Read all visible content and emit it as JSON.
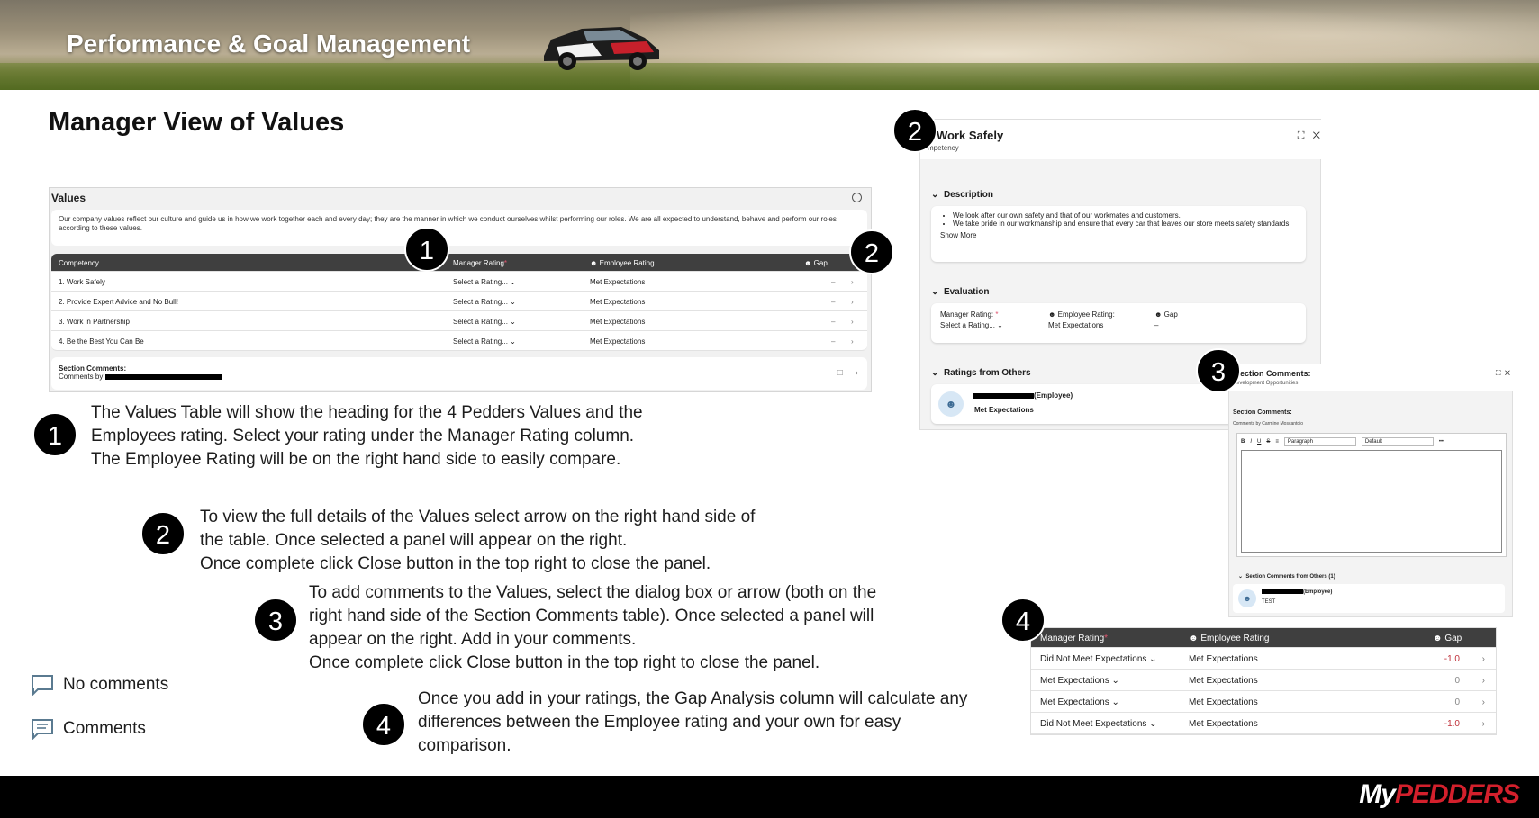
{
  "header": {
    "title": "Performance & Goal Management"
  },
  "page_title": "Manager View of Values",
  "values_table": {
    "title": "Values",
    "description": "Our company values reflect our culture and guide us in how we work together each and every day; they are the manner in which we conduct ourselves whilst performing our roles.  We are all expected to understand, behave and perform our roles according to these values.",
    "columns": {
      "competency": "Competency",
      "manager_rating": "Manager Rating",
      "required_mark": "*",
      "employee_rating": "Employee Rating",
      "gap": "Gap"
    },
    "rows": [
      {
        "competency": "1. Work Safely",
        "manager_rating": "Select a Rating...",
        "employee_rating": "Met Expectations",
        "gap": "–"
      },
      {
        "competency": "2.  Provide Expert Advice and No Bull!",
        "manager_rating": "Select a Rating...",
        "employee_rating": "Met Expectations",
        "gap": "–"
      },
      {
        "competency": "3.  Work in Partnership",
        "manager_rating": "Select a Rating...",
        "employee_rating": "Met Expectations",
        "gap": "–"
      },
      {
        "competency": "4.  Be the Best You Can Be",
        "manager_rating": "Select a Rating...",
        "employee_rating": "Met Expectations",
        "gap": "–"
      }
    ],
    "section_comments_title": "Section Comments:",
    "comments_by_prefix": "Comments by"
  },
  "badges": {
    "one": "1",
    "two": "2",
    "three": "3",
    "four": "4"
  },
  "instructions": {
    "one": "The Values Table will show the heading for the 4 Pedders Values and the Employees rating. Select your rating under the Manager Rating column. The Employee Rating will be on the right hand side to easily compare.",
    "two_line1": "To view the full details of the Values select arrow on the right hand side of the table. Once selected a panel will appear on the right.",
    "two_line2": "Once complete click Close button in the top right to close the panel.",
    "three_line1": "To add comments to the Values, select the dialog box or arrow (both on the right hand side of the Section Comments table). Once selected a panel will appear on the right. Add in your comments.",
    "three_line2": "Once complete click Close button in the top right to close the panel.",
    "four": "Once you add in your ratings, the Gap Analysis column will calculate any differences between the Employee rating and your own for easy comparison."
  },
  "legend": {
    "no_comments": "No comments",
    "comments": "Comments"
  },
  "detail_panel": {
    "title": "Work Safely",
    "subtitle": "mpetency",
    "description_heading": "Description",
    "bullets": [
      "We look after our own safety and that of our workmates and customers.",
      "We take pride in our workmanship and ensure that every car that leaves our store meets safety standards."
    ],
    "show_more": "Show More",
    "evaluation_heading": "Evaluation",
    "manager_rating_label": "Manager Rating:",
    "manager_rating_value": "Select a Rating...",
    "employee_rating_label": "Employee Rating:",
    "employee_rating_value": "Met Expectations",
    "gap_label": "Gap",
    "gap_value": "–",
    "ratings_from_others_heading": "Ratings from Others",
    "other_role": "(Employee)",
    "other_value": "Met Expectations"
  },
  "comments_panel": {
    "title": "ection Comments:",
    "subtitle": "evelopment Opportunities",
    "section_comments_label": "Section Comments:",
    "comments_by": "Comments by Carmine Moscantoio",
    "toolbar": {
      "bold": "B",
      "italic": "I",
      "underline": "U",
      "strike": "S",
      "align": "≡",
      "paragraph": "Paragraph",
      "font": "Default",
      "more": "•••"
    },
    "others_heading": "Section Comments from Others (1)",
    "other_role": "(Employee)",
    "other_text": "TEST"
  },
  "gap_table": {
    "columns": {
      "manager_rating": "Manager Rating",
      "employee_rating": "Employee Rating",
      "gap": "Gap"
    },
    "rows": [
      {
        "manager_rating": "Did Not Meet Expectations",
        "employee_rating": "Met Expectations",
        "gap": "-1.0"
      },
      {
        "manager_rating": "Met Expectations",
        "employee_rating": "Met Expectations",
        "gap": "0"
      },
      {
        "manager_rating": "Met Expectations",
        "employee_rating": "Met Expectations",
        "gap": "0"
      },
      {
        "manager_rating": "Did Not Meet Expectations",
        "employee_rating": "Met Expectations",
        "gap": "-1.0"
      }
    ]
  },
  "footer": {
    "logo_my": "My",
    "logo_brand": "PEDDERS"
  },
  "colors": {
    "table_header": "#3f3f3f",
    "negative_gap": "#c0313a",
    "required": "#e0556f",
    "logo_red": "#d4202c"
  }
}
